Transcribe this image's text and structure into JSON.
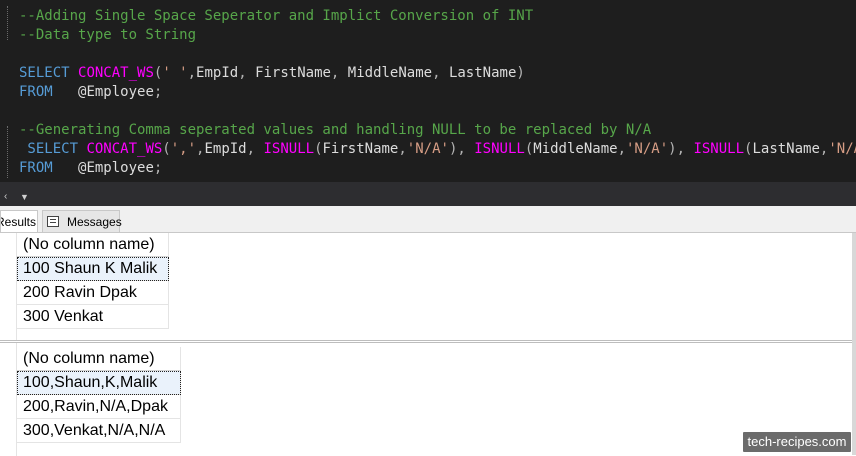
{
  "editor": {
    "lines": [
      [
        {
          "t": "--Adding Single Space Seperator and Implict Conversion of INT",
          "c": "cmt"
        }
      ],
      [
        {
          "t": "--Data type to String",
          "c": "cmt"
        }
      ],
      [],
      [
        {
          "t": "SELECT ",
          "c": "kw"
        },
        {
          "t": "CONCAT_WS",
          "c": "fn"
        },
        {
          "t": "(",
          "c": "gy"
        },
        {
          "t": "' '",
          "c": "str"
        },
        {
          "t": ",",
          "c": "gy"
        },
        {
          "t": "EmpId",
          "c": "id"
        },
        {
          "t": ", ",
          "c": "gy"
        },
        {
          "t": "FirstName",
          "c": "id"
        },
        {
          "t": ", ",
          "c": "gy"
        },
        {
          "t": "MiddleName",
          "c": "id"
        },
        {
          "t": ", ",
          "c": "gy"
        },
        {
          "t": "LastName",
          "c": "id"
        },
        {
          "t": ")",
          "c": "gy"
        }
      ],
      [
        {
          "t": "FROM   ",
          "c": "kw"
        },
        {
          "t": "@Employee",
          "c": "var"
        },
        {
          "t": ";",
          "c": "gy"
        }
      ],
      [],
      [
        {
          "t": "--Generating Comma seperated values and handling NULL to be replaced by N/A",
          "c": "cmt"
        }
      ],
      [
        {
          "t": " SELECT ",
          "c": "kw"
        },
        {
          "t": "CONCAT_WS",
          "c": "fn"
        },
        {
          "t": "(",
          "c": "gy"
        },
        {
          "t": "','",
          "c": "str"
        },
        {
          "t": ",",
          "c": "gy"
        },
        {
          "t": "EmpId",
          "c": "id"
        },
        {
          "t": ", ",
          "c": "gy"
        },
        {
          "t": "ISNULL",
          "c": "fn"
        },
        {
          "t": "(",
          "c": "gy"
        },
        {
          "t": "FirstName",
          "c": "id"
        },
        {
          "t": ",",
          "c": "gy"
        },
        {
          "t": "'N/A'",
          "c": "str"
        },
        {
          "t": "), ",
          "c": "gy"
        },
        {
          "t": "ISNULL",
          "c": "fn"
        },
        {
          "t": "(",
          "c": "gy"
        },
        {
          "t": "MiddleName",
          "c": "id"
        },
        {
          "t": ",",
          "c": "gy"
        },
        {
          "t": "'N/A'",
          "c": "str"
        },
        {
          "t": "), ",
          "c": "gy"
        },
        {
          "t": "ISNULL",
          "c": "fn"
        },
        {
          "t": "(",
          "c": "gy"
        },
        {
          "t": "LastName",
          "c": "id"
        },
        {
          "t": ",",
          "c": "gy"
        },
        {
          "t": "'N/A'",
          "c": "str"
        },
        {
          "t": "))",
          "c": "gy"
        }
      ],
      [
        {
          "t": "FROM   ",
          "c": "kw"
        },
        {
          "t": "@Employee",
          "c": "var"
        },
        {
          "t": ";",
          "c": "gy"
        }
      ]
    ]
  },
  "tabs": {
    "results_label": "Results",
    "messages_label": "Messages"
  },
  "grid1": {
    "header": "(No column name)",
    "rows": [
      "100 Shaun K Malik",
      "200 Ravin Dpak",
      "300 Venkat"
    ]
  },
  "grid2": {
    "header": "(No column name)",
    "rows": [
      "100,Shaun,K,Malik",
      "200,Ravin,N/A,Dpak",
      "300,Venkat,N/A,N/A"
    ]
  },
  "watermark": "tech-recipes.com"
}
